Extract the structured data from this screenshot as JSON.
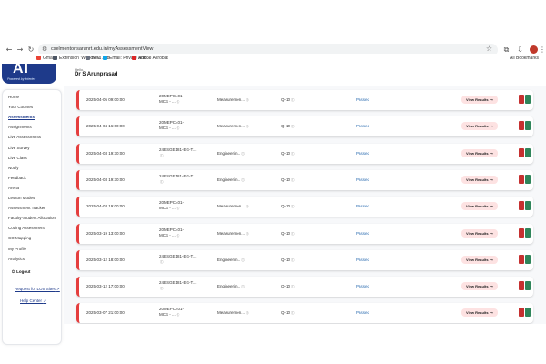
{
  "browser": {
    "url": "cselmentor.saranrt.edu.in/myAssessmentView",
    "bookmarks": [
      {
        "label": "Gmail",
        "color": "#ea4335"
      },
      {
        "label": "Extension 'WoodleT...",
        "color": "#4b5563"
      },
      {
        "label": "New Tab",
        "color": "#6b7280"
      },
      {
        "label": "Email: Private and ...",
        "color": "#0ea5e9"
      },
      {
        "label": "Adobe Acrobat",
        "color": "#dc2626"
      }
    ],
    "all_bookmarks": "All Bookmarks"
  },
  "logo": {
    "mark": "AI",
    "tagline": "Powered by Intertex"
  },
  "header": {
    "greeting": "Hello,",
    "user": "Dr S Arunprasad"
  },
  "sidebar": {
    "items": [
      {
        "label": "Home"
      },
      {
        "label": "Your Courses"
      },
      {
        "label": "Assessments"
      },
      {
        "label": "Assignments"
      },
      {
        "label": "Live Assessments"
      },
      {
        "label": "Live Survey"
      },
      {
        "label": "Live Class"
      },
      {
        "label": "Notify"
      },
      {
        "label": "Feedback"
      },
      {
        "label": "Arena"
      },
      {
        "label": "Lesson Modes"
      },
      {
        "label": "Assessment Tracker"
      },
      {
        "label": "Faculty-Student Allocation"
      },
      {
        "label": "Coding Assessment"
      },
      {
        "label": "CO Mapping"
      },
      {
        "label": "My Profile"
      },
      {
        "label": "Analytics"
      }
    ],
    "active_index": 2,
    "logout": "Logout",
    "request_link": "Request for LOS Sites",
    "help_link": "Help Center"
  },
  "colors": {
    "accent": "#1e3a8a",
    "card_border": "#e53e3e",
    "status": "#2b6cb0",
    "view_btn_bg": "#fde2e2"
  },
  "rows": [
    {
      "date": "2025-04-05 09:00:00",
      "course1": "20MEPC401-",
      "course2": "MCS - ...",
      "topic": "Measuremen...",
      "qcount": "Q-10",
      "status": "Passed",
      "action": "View Results"
    },
    {
      "date": "2025-04-04 16:00:00",
      "course1": "20MEPC401-",
      "course2": "MCS - ...",
      "topic": "Measuremen...",
      "qcount": "Q-10",
      "status": "Passed",
      "action": "View Results"
    },
    {
      "date": "2025-04-03 19:30:00",
      "course1": "24ESGE181-EG-T...",
      "course2": "",
      "topic": "Engineerin...",
      "qcount": "Q-10",
      "status": "Passed",
      "action": "View Results"
    },
    {
      "date": "2025-04-03 19:30:00",
      "course1": "24ESGE181-EG-T...",
      "course2": "",
      "topic": "Engineerin...",
      "qcount": "Q-10",
      "status": "Passed",
      "action": "View Results"
    },
    {
      "date": "2025-04-03 19:00:00",
      "course1": "20MEPC401-",
      "course2": "MCS - ...",
      "topic": "Measuremen...",
      "qcount": "Q-10",
      "status": "Passed",
      "action": "View Results"
    },
    {
      "date": "2025-03-19 13:00:00",
      "course1": "20MEPC401-",
      "course2": "MCS - ...",
      "topic": "Measuremen...",
      "qcount": "Q-10",
      "status": "Passed",
      "action": "View Results"
    },
    {
      "date": "2025-03-12 18:00:00",
      "course1": "24ESGE181-EG-T...",
      "course2": "",
      "topic": "Engineerin...",
      "qcount": "Q-10",
      "status": "Passed",
      "action": "View Results"
    },
    {
      "date": "2025-03-12 17:00:00",
      "course1": "24ESGE181-EG-T...",
      "course2": "",
      "topic": "Engineerin...",
      "qcount": "Q-10",
      "status": "Passed",
      "action": "View Results"
    },
    {
      "date": "2025-03-07 21:00:00",
      "course1": "20MEPC401-",
      "course2": "MCS - ...",
      "topic": "Measuremen...",
      "qcount": "Q-10",
      "status": "Passed",
      "action": "View Results"
    }
  ]
}
